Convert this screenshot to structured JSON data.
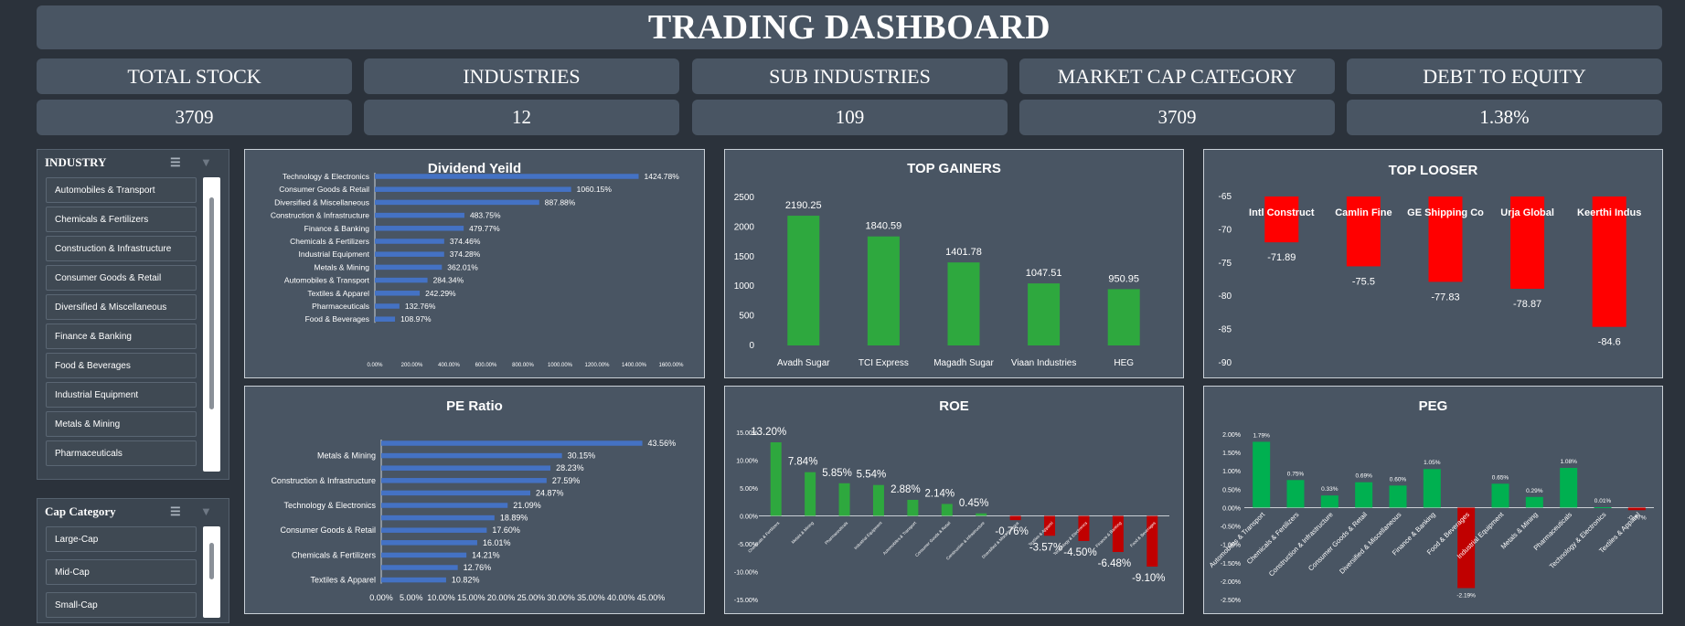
{
  "title": "TRADING DASHBOARD",
  "kpis": [
    {
      "label": "TOTAL STOCK",
      "value": "3709"
    },
    {
      "label": "INDUSTRIES",
      "value": "12"
    },
    {
      "label": "SUB INDUSTRIES",
      "value": "109"
    },
    {
      "label": "MARKET CAP CATEGORY",
      "value": "3709"
    },
    {
      "label": "DEBT TO EQUITY",
      "value": "1.38%"
    }
  ],
  "industry_slicer": {
    "title": "INDUSTRY",
    "items": [
      "Automobiles & Transport",
      "Chemicals & Fertilizers",
      "Construction & Infrastructure",
      "Consumer Goods & Retail",
      "Diversified & Miscellaneous",
      "Finance & Banking",
      "Food & Beverages",
      "Industrial Equipment",
      "Metals & Mining",
      "Pharmaceuticals"
    ],
    "icons": {
      "multiselect": "multi-select-icon",
      "clear": "clear-filter-icon"
    }
  },
  "cap_slicer": {
    "title": "Cap Category",
    "items": [
      "Large-Cap",
      "Mid-Cap",
      "Small-Cap"
    ],
    "icons": {
      "multiselect": "multi-select-icon",
      "clear": "clear-filter-icon"
    }
  },
  "colors": {
    "background": "#2b323b",
    "panel": "#495563",
    "blue": "#4472c4",
    "green": "#2ea83e",
    "red": "#ff0000",
    "dark_red": "#c00000",
    "peg_green": "#00b050"
  },
  "chart_data": [
    {
      "id": "dividend",
      "type": "bar",
      "orientation": "horizontal",
      "title": "Dividend Yeild",
      "categories": [
        "Technology & Electronics",
        "Consumer Goods & Retail",
        "Diversified & Miscellaneous",
        "Construction & Infrastructure",
        "Finance & Banking",
        "Chemicals & Fertilizers",
        "Industrial Equipment",
        "Metals & Mining",
        "Automobiles & Transport",
        "Textiles & Apparel",
        "Pharmaceuticals",
        "Food & Beverages"
      ],
      "values": [
        1424.78,
        1060.15,
        887.88,
        483.75,
        479.77,
        374.46,
        374.28,
        362.01,
        284.34,
        242.29,
        132.76,
        108.97
      ],
      "value_labels": [
        "1424.78%",
        "1060.15%",
        "887.88%",
        "483.75%",
        "479.77%",
        "374.46%",
        "374.28%",
        "362.01%",
        "284.34%",
        "242.29%",
        "132.76%",
        "108.97%"
      ],
      "xlim": [
        0,
        1600
      ],
      "ticks": [
        0,
        200,
        400,
        600,
        800,
        1000,
        1200,
        1400,
        1600
      ],
      "tick_labels": [
        "0.00%",
        "200.00%",
        "400.00%",
        "600.00%",
        "800.00%",
        "1000.00%",
        "1200.00%",
        "1400.00%",
        "1600.00%"
      ]
    },
    {
      "id": "gainers",
      "type": "bar",
      "title": "TOP GAINERS",
      "categories": [
        "Avadh Sugar",
        "TCI Express",
        "Magadh Sugar",
        "Viaan Industries",
        "HEG"
      ],
      "values": [
        2190.25,
        1840.59,
        1401.78,
        1047.51,
        950.95
      ],
      "value_labels": [
        "2190.25",
        "1840.59",
        "1401.78",
        "1047.51",
        "950.95"
      ],
      "ylim": [
        0,
        2500
      ],
      "ticks": [
        0,
        500,
        1000,
        1500,
        2000,
        2500
      ],
      "tick_labels": [
        "0",
        "500",
        "1000",
        "1500",
        "2000",
        "2500"
      ]
    },
    {
      "id": "loosers",
      "type": "bar",
      "title": "TOP LOOSER",
      "categories": [
        "Intl Construct",
        "Camlin Fine",
        "GE Shipping Co",
        "Urja Global",
        "Keerthi Indus"
      ],
      "values": [
        -71.89,
        -75.5,
        -77.83,
        -78.87,
        -84.6
      ],
      "value_labels": [
        "-71.89",
        "-75.5",
        "-77.83",
        "-78.87",
        "-84.6"
      ],
      "ylim": [
        -90,
        -65
      ],
      "ticks": [
        -65,
        -70,
        -75,
        -80,
        -85,
        -90
      ],
      "tick_labels": [
        "-65",
        "-70",
        "-75",
        "-80",
        "-85",
        "-90"
      ]
    },
    {
      "id": "pe",
      "type": "bar",
      "orientation": "horizontal",
      "title": "PE Ratio",
      "categories": [
        "",
        "Metals & Mining",
        "",
        "Construction & Infrastructure",
        "",
        "Technology & Electronics",
        "",
        "Consumer Goods & Retail",
        "",
        "Chemicals & Fertilizers",
        "",
        "Textiles & Apparel"
      ],
      "values": [
        43.56,
        30.15,
        28.23,
        27.59,
        24.87,
        21.09,
        18.89,
        17.6,
        16.01,
        14.21,
        12.76,
        10.82
      ],
      "value_labels": [
        "43.56%",
        "30.15%",
        "28.23%",
        "27.59%",
        "24.87%",
        "21.09%",
        "18.89%",
        "17.60%",
        "16.01%",
        "14.21%",
        "12.76%",
        "10.82%"
      ],
      "xlim": [
        0,
        45
      ],
      "ticks": [
        0,
        5,
        10,
        15,
        20,
        25,
        30,
        35,
        40,
        45
      ],
      "tick_labels": [
        "0.00%",
        "5.00%",
        "10.00%",
        "15.00%",
        "20.00%",
        "25.00%",
        "30.00%",
        "35.00%",
        "40.00%",
        "45.00%"
      ]
    },
    {
      "id": "roe",
      "type": "bar",
      "title": "ROE",
      "categories": [
        "Chemicals & Fertilizers",
        "Metals & Mining",
        "Pharmaceuticals",
        "Industrial Equipment",
        "Automobiles & Transport",
        "Consumer Goods & Retail",
        "Construction & Infrastructure",
        "Diversified & Miscellaneous",
        "Textiles & Apparel",
        "Technology & Electronics",
        "Finance & Banking",
        "Food & Beverages"
      ],
      "values": [
        13.2,
        7.84,
        5.85,
        5.54,
        2.88,
        2.14,
        0.45,
        -0.76,
        -3.57,
        -4.5,
        -6.48,
        -9.1
      ],
      "value_labels": [
        "13.20%",
        "7.84%",
        "5.85%",
        "5.54%",
        "2.88%",
        "2.14%",
        "0.45%",
        "-0.76%",
        "-3.57%",
        "-4.50%",
        "-6.48%",
        "-9.10%"
      ],
      "ylim": [
        -15,
        15
      ],
      "ticks": [
        15,
        10,
        5,
        0,
        -5,
        -10,
        -15
      ],
      "tick_labels": [
        "15.00%",
        "10.00%",
        "5.00%",
        "0.00%",
        "-5.00%",
        "-10.00%",
        "-15.00%"
      ]
    },
    {
      "id": "peg",
      "type": "bar",
      "title": "PEG",
      "categories": [
        "Automobiles & Transport",
        "Chemicals & Fertilizers",
        "Construction & Infrastructure",
        "Consumer Goods & Retail",
        "Diversified & Miscellaneous",
        "Finance & Banking",
        "Food & Beverages",
        "Industrial Equipment",
        "Metals & Mining",
        "Pharmaceuticals",
        "Technology & Electronics",
        "Textiles & Apparel"
      ],
      "values": [
        1.79,
        0.75,
        0.33,
        0.69,
        0.6,
        1.05,
        -2.19,
        0.65,
        0.29,
        1.08,
        0.01,
        -0.07
      ],
      "value_labels": [
        "1.79%",
        "0.75%",
        "0.33%",
        "0.69%",
        "0.60%",
        "1.05%",
        "-2.19%",
        "0.65%",
        "0.29%",
        "1.08%",
        "0.01%",
        "-0.07%"
      ],
      "ylim": [
        -2.5,
        2
      ],
      "ticks": [
        2,
        1.5,
        1,
        0.5,
        0,
        -0.5,
        -1,
        -1.5,
        -2,
        -2.5
      ],
      "tick_labels": [
        "2.00%",
        "1.50%",
        "1.00%",
        "0.50%",
        "0.00%",
        "-0.50%",
        "-1.00%",
        "-1.50%",
        "-2.00%",
        "-2.50%"
      ]
    }
  ]
}
